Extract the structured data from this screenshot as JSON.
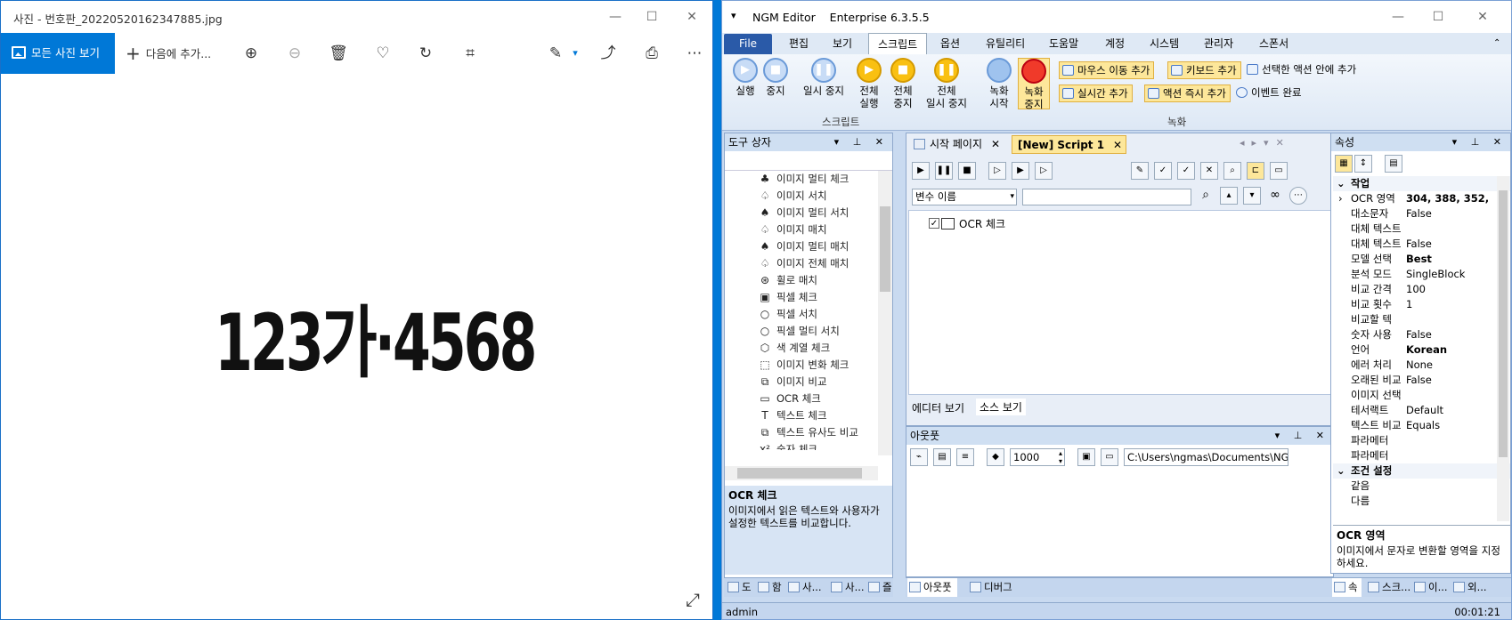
{
  "photos": {
    "title": "사진 - 번호판_20220520162347885.jpg",
    "all_photos_label": "모든 사진 보기",
    "add_to_label": "다음에 추가...",
    "plate_text": "123가·4568"
  },
  "ngm": {
    "title": "NGM Editor    Enterprise 6.3.5.5",
    "tabs": [
      "File",
      "편집",
      "보기",
      "스크립트",
      "옵션",
      "유틸리티",
      "도움말",
      "계정",
      "시스템",
      "관리자",
      "스폰서"
    ],
    "ribbon": {
      "run": "실행",
      "stop": "중지",
      "pause": "일시 중지",
      "run_all": "전체\n실행",
      "stop_all": "전체\n중지",
      "pause_all": "전체\n일시 중지",
      "rec_start": "녹화\n시작",
      "rec_stop": "녹화\n중지",
      "script_group": "스크립트",
      "record_group": "녹화",
      "mouse_move_add": "마우스 이동 추가",
      "keyboard_add": "키보드 추가",
      "add_in_selected": "선택한 액션 안에 추가",
      "realtime_add": "실시간 추가",
      "action_add": "액션 즉시 추가",
      "event_complete": "이벤트 완료"
    },
    "toolbox": {
      "title": "도구 상자",
      "items": [
        "이미지 멀티 체크",
        "이미지 서치",
        "이미지 멀티 서치",
        "이미지 매치",
        "이미지 멀티 매치",
        "이미지 전체 매치",
        "휠로 매치",
        "픽셀 체크",
        "픽셀 서치",
        "픽셀 멀티 서치",
        "색 계열 체크",
        "이미지 변화 체크",
        "이미지 비교",
        "OCR 체크",
        "텍스트 체크",
        "텍스트 유사도 비교",
        "숫자 체크"
      ],
      "desc_title": "OCR 체크",
      "desc_text": "이미지에서 읽은 텍스트와 사용자가 설정한 텍스트를 비교합니다.",
      "bottom_tabs": [
        "도",
        "함",
        "사...",
        "사...",
        "즐"
      ]
    },
    "editor": {
      "start_tab": "시작 페이지",
      "script_tab": "[New] Script 1",
      "var_select": "변수 이름",
      "node": "OCR 체크",
      "view_editor": "에디터 보기",
      "view_source": "소스 보기"
    },
    "output": {
      "title": "아웃풋",
      "count": "1000",
      "path": "C:\\Users\\ngmas\\Documents\\NGM6\\",
      "tabs": [
        "아웃풋",
        "디버그"
      ]
    },
    "props": {
      "title": "속성",
      "section_work": "작업",
      "rows": [
        {
          "k": "OCR 영역",
          "v": "304, 388, 352,"
        },
        {
          "k": "대소문자",
          "v": "False"
        },
        {
          "k": "대체 텍스트",
          "v": ""
        },
        {
          "k": "대체 텍스트",
          "v": "False"
        },
        {
          "k": "모델 선택",
          "v": "Best"
        },
        {
          "k": "분석 모드",
          "v": "SingleBlock"
        },
        {
          "k": "비교 간격",
          "v": "100"
        },
        {
          "k": "비교 횟수",
          "v": "1"
        },
        {
          "k": "비교할 텍",
          "v": ""
        },
        {
          "k": "숫자 사용",
          "v": "False"
        },
        {
          "k": "언어",
          "v": "Korean"
        },
        {
          "k": "에러 처리",
          "v": "None"
        },
        {
          "k": "오래된 비교",
          "v": "False"
        },
        {
          "k": "이미지 선택",
          "v": ""
        },
        {
          "k": "테서랙트",
          "v": "Default"
        },
        {
          "k": "텍스트 비교",
          "v": "Equals"
        },
        {
          "k": "파라메터",
          "v": ""
        },
        {
          "k": "파라메터",
          "v": ""
        }
      ],
      "section_cond": "조건 설정",
      "cond_rows": [
        "같음",
        "다름"
      ],
      "desc_title": "OCR 영역",
      "desc_text": "이미지에서 문자로 변환할 영역을 지정하세요.",
      "bottom_tabs": [
        "속",
        "스크...",
        "이...",
        "외..."
      ]
    },
    "status": {
      "user": "admin",
      "time": "00:01:21"
    }
  }
}
